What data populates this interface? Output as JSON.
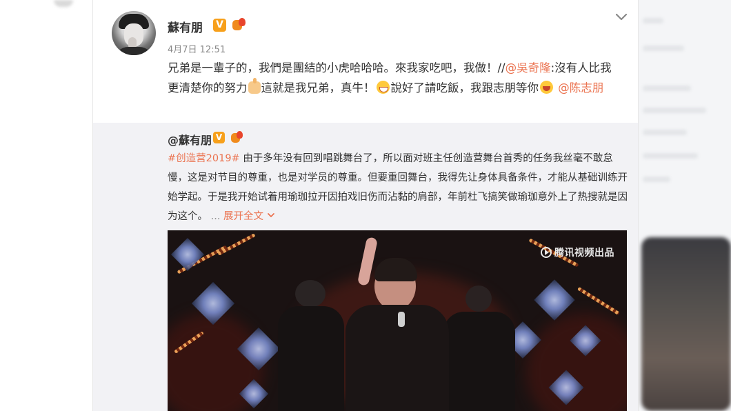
{
  "post": {
    "username": "蘇有朋",
    "verified_badge": "V",
    "timestamp": "4月7日 12:51",
    "text": {
      "part1": "兄弟是一輩子的，我們是團結的小虎哈哈哈。來我家吃吧，我做！//",
      "mention1": "@吳奇隆",
      "part2": ":沒有人比我更清楚你的努力",
      "part3": "這就是我兄弟，真牛！",
      "part4": "說好了請吃飯，我跟志朋等你",
      "mention2": "@陈志朋"
    }
  },
  "repost": {
    "username": "@蘇有朋",
    "verified_badge": "V",
    "hashtag": "#创造营2019#",
    "text": "由于多年没有回到唱跳舞台了，所以面对班主任创造营舞台首秀的任务我丝毫不敢怠慢，这是对节目的尊重，也是对学员的尊重。但要重回舞台，我得先让身体具备条件，才能从基础训练开始学起。于是我开始试着用瑜珈拉开因拍戏旧伤而沾黏的肩部，年前杜飞搞笑做瑜珈意外上了热搜就是因为这个。",
    "ellipsis": "...",
    "expand_label": "展开全文",
    "video": {
      "watermark": "腾讯视频出品"
    }
  },
  "icons": {
    "chevron": "chevron-down-icon",
    "emoji_1": "thumbs-up-emoji",
    "emoji_2": "grin-emoji",
    "emoji_3": "laugh-emoji"
  },
  "colors": {
    "link": "#eb7350",
    "verified": "#f7a01b",
    "repost_bg": "#f2f2f5"
  }
}
